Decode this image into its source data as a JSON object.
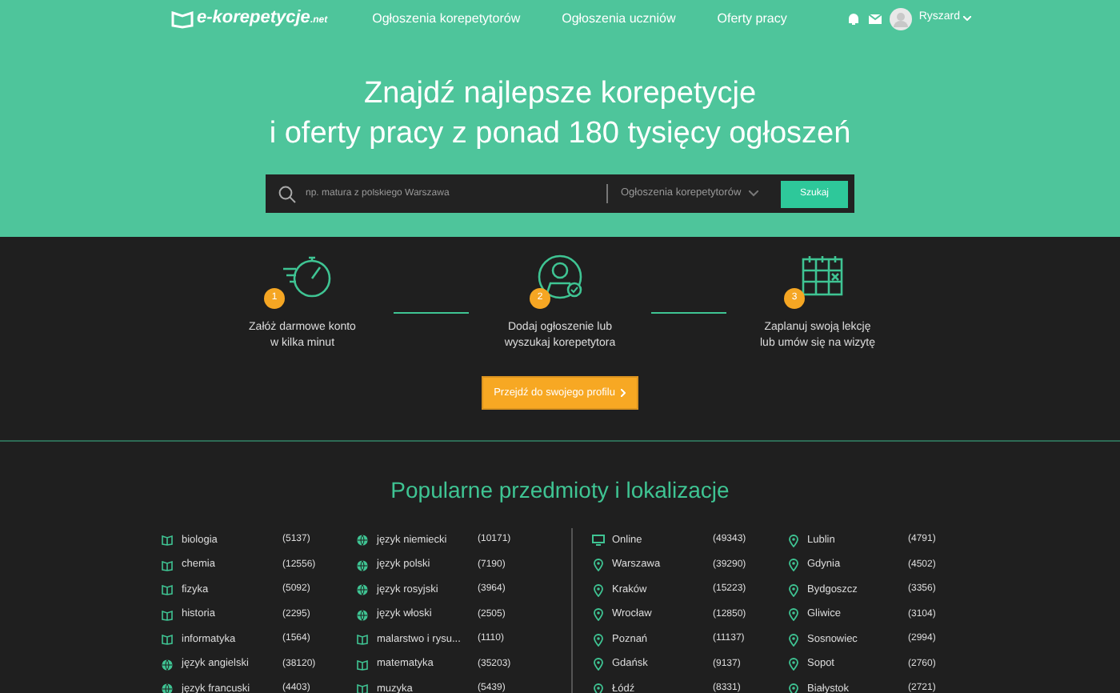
{
  "nav": {
    "logo": "e-korepetycje",
    "logo_suffix": ".net",
    "links": [
      "Ogłoszenia korepetytorów",
      "Ogłoszenia uczniów",
      "Oferty pracy"
    ],
    "user": "Ryszard"
  },
  "hero": {
    "title_lines": [
      "Znajdź najlepsze korepetycje",
      "i oferty pracy z ponad 180 tysięcy ogłoszeń"
    ],
    "search": {
      "placeholder": "np. matura z polskiego Warszawa",
      "category": "Ogłoszenia korepetytorów",
      "button": "Szukaj"
    }
  },
  "steps": [
    {
      "number": "1",
      "lines": [
        "Załóż darmowe konto",
        "w kilka minut"
      ]
    },
    {
      "number": "2",
      "lines": [
        "Dodaj ogłoszenie lub",
        "wyszukaj korepetytora"
      ]
    },
    {
      "number": "3",
      "lines": [
        "Zaplanuj swoją lekcję",
        "lub umów się na wizytę"
      ]
    }
  ],
  "profile_button": "Przejdź do swojego profilu",
  "popular": {
    "title": "Popularne przedmioty i lokalizacje",
    "columns": [
      [
        {
          "kind": "subject",
          "name": "biologia",
          "count": "(5137)"
        },
        {
          "kind": "subject",
          "name": "chemia",
          "count": "(12556)"
        },
        {
          "kind": "subject",
          "name": "fizyka",
          "count": "(5092)"
        },
        {
          "kind": "subject",
          "name": "historia",
          "count": "(2295)"
        },
        {
          "kind": "subject",
          "name": "informatyka",
          "count": "(1564)"
        },
        {
          "kind": "language",
          "name": "język angielski",
          "count": "(38120)"
        },
        {
          "kind": "language",
          "name": "język francuski",
          "count": "(4403)"
        }
      ],
      [
        {
          "kind": "language",
          "name": "język niemiecki",
          "count": "(10171)"
        },
        {
          "kind": "language",
          "name": "język polski",
          "count": "(7190)"
        },
        {
          "kind": "language",
          "name": "język rosyjski",
          "count": "(3964)"
        },
        {
          "kind": "language",
          "name": "język włoski",
          "count": "(2505)"
        },
        {
          "kind": "subject",
          "name": "malarstwo i rysu...",
          "count": "(1110)"
        },
        {
          "kind": "subject",
          "name": "matematyka",
          "count": "(35203)"
        },
        {
          "kind": "subject",
          "name": "muzyka",
          "count": "(5439)"
        }
      ],
      [
        {
          "kind": "online",
          "name": "Online",
          "count": "(49343)"
        },
        {
          "kind": "city",
          "name": "Warszawa",
          "count": "(39290)"
        },
        {
          "kind": "city",
          "name": "Kraków",
          "count": "(15223)"
        },
        {
          "kind": "city",
          "name": "Wrocław",
          "count": "(12850)"
        },
        {
          "kind": "city",
          "name": "Poznań",
          "count": "(11137)"
        },
        {
          "kind": "city",
          "name": "Gdańsk",
          "count": "(9137)"
        },
        {
          "kind": "city",
          "name": "Łódź",
          "count": "(8331)"
        }
      ],
      [
        {
          "kind": "city",
          "name": "Lublin",
          "count": "(4791)"
        },
        {
          "kind": "city",
          "name": "Gdynia",
          "count": "(4502)"
        },
        {
          "kind": "city",
          "name": "Bydgoszcz",
          "count": "(3356)"
        },
        {
          "kind": "city",
          "name": "Gliwice",
          "count": "(3104)"
        },
        {
          "kind": "city",
          "name": "Sosnowiec",
          "count": "(2994)"
        },
        {
          "kind": "city",
          "name": "Sopot",
          "count": "(2760)"
        },
        {
          "kind": "city",
          "name": "Białystok",
          "count": "(2721)"
        }
      ]
    ]
  }
}
